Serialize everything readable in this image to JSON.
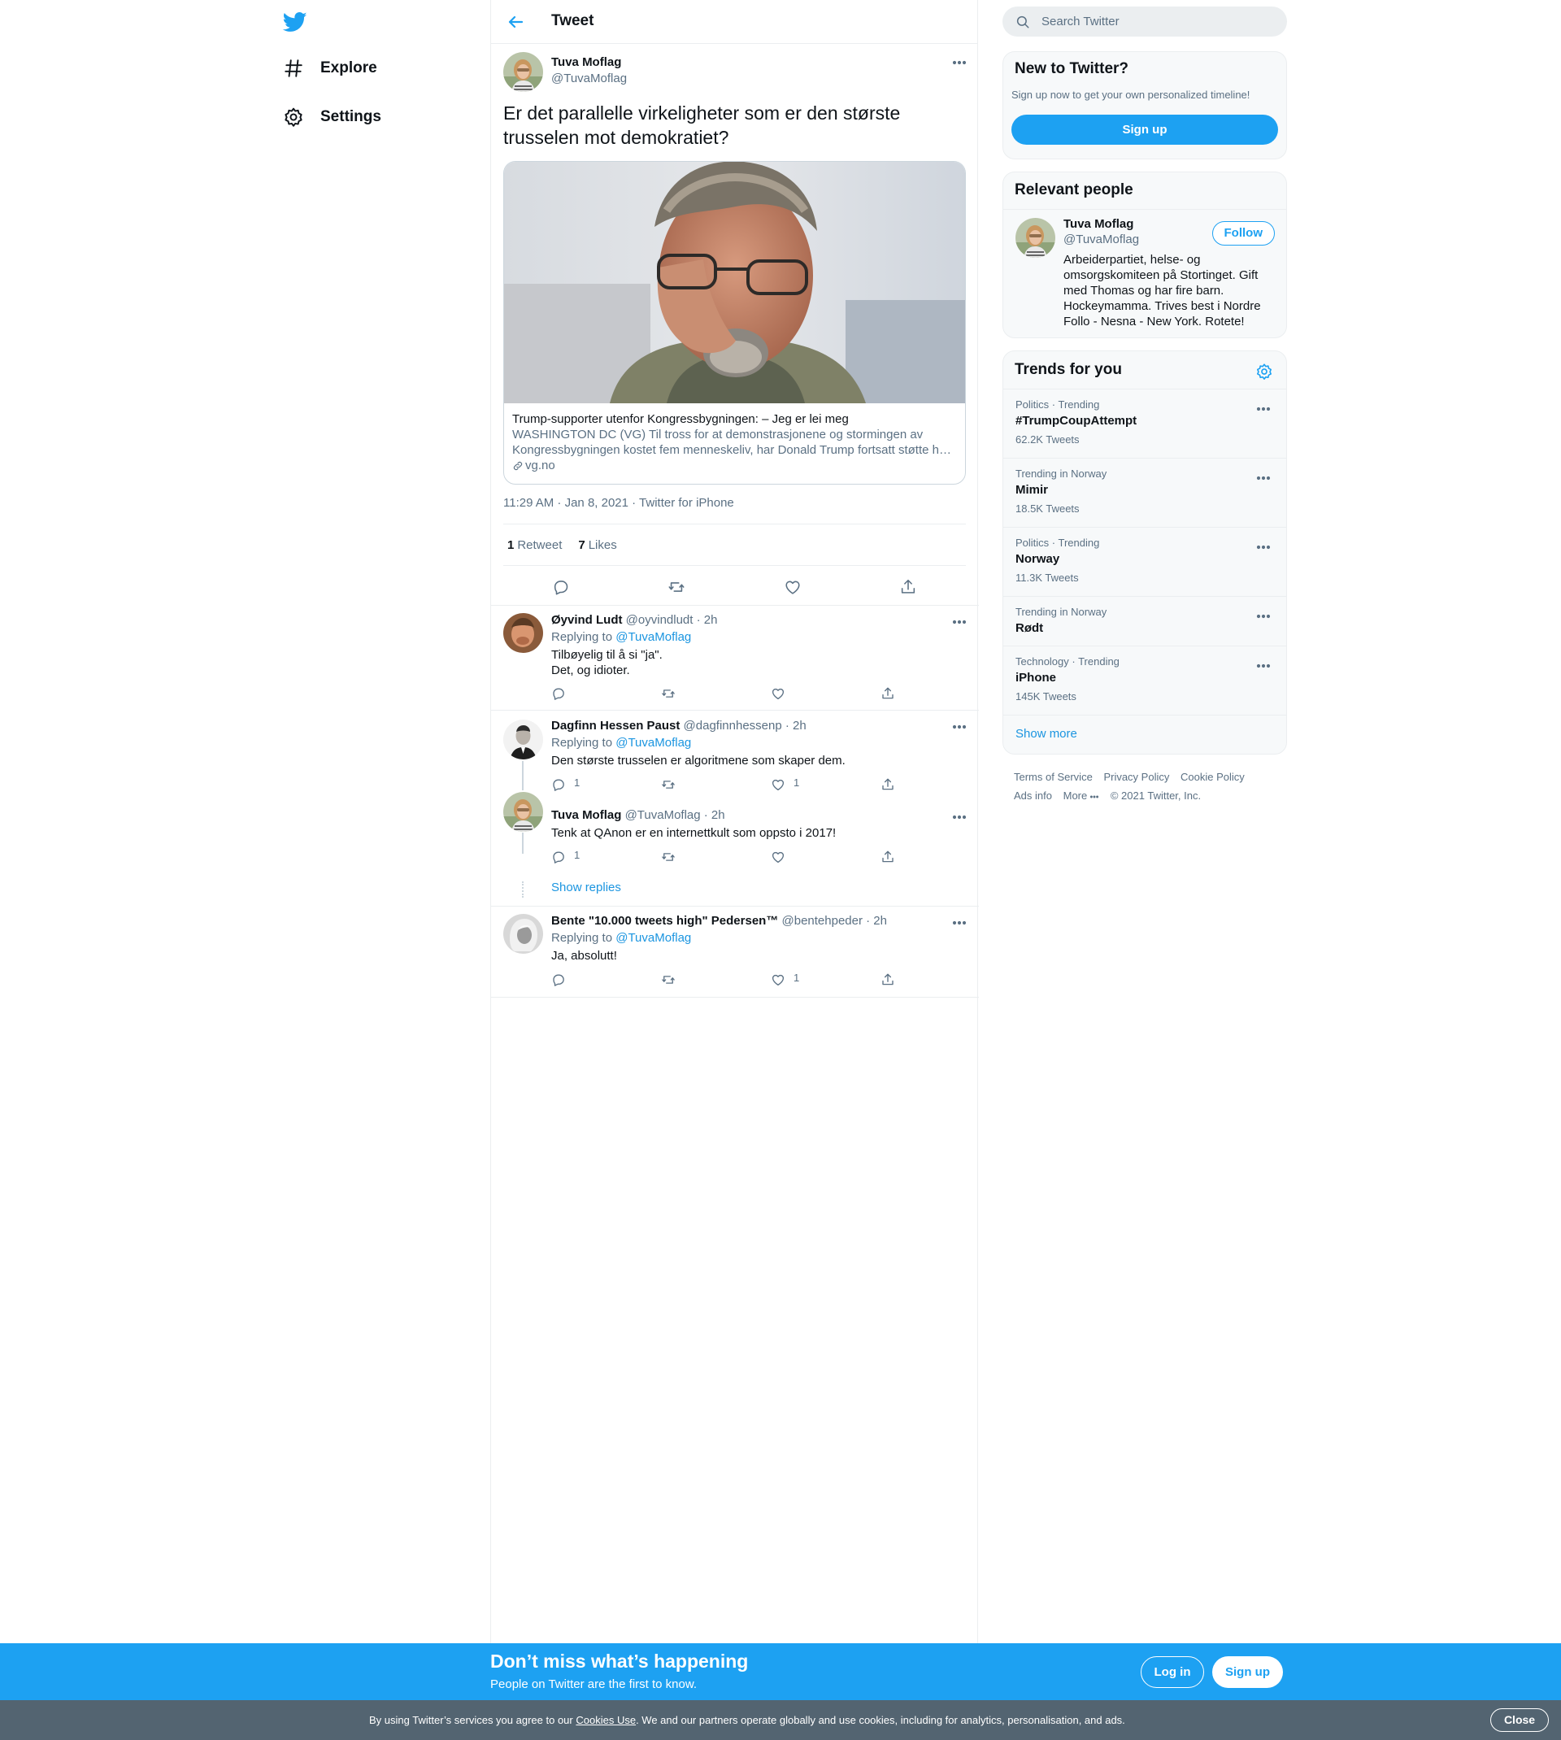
{
  "nav": {
    "explore_label": "Explore",
    "settings_label": "Settings"
  },
  "header": {
    "title": "Tweet"
  },
  "tweet": {
    "author_name": "Tuva Moflag",
    "author_handle": "@TuvaMoflag",
    "text": "Er det parallelle virkeligheter som er den største trusselen mot demokratiet?",
    "card": {
      "title": "Trump-supporter utenfor Kongressbygningen: – Jeg er lei meg",
      "desc_line1": "WASHINGTON DC (VG) Til tross for at demonstrasjonene og stormingen av",
      "desc_line2": "Kongressbygningen kostet fem menneskeliv, har Donald Trump fortsatt støtte h…",
      "domain": "vg.no"
    },
    "meta": "11:29 AM · Jan 8, 2021 · Twitter for iPhone",
    "retweets_count": "1",
    "retweets_label": "Retweet",
    "likes_count": "7",
    "likes_label": "Likes"
  },
  "replies": [
    {
      "name": "Øyvind Ludt",
      "handle": "@oyvindludt · 2h",
      "replying_prefix": "Replying to",
      "replying_to": "@TuvaMoflag",
      "text_line1": "Tilbøyelig til å si \"ja\".",
      "text_line2": "Det, og idioter.",
      "reply_count": "",
      "like_count": ""
    },
    {
      "name": "Dagfinn Hessen Paust",
      "handle": "@dagfinnhessenp · 2h",
      "replying_prefix": "Replying to",
      "replying_to": "@TuvaMoflag",
      "text_line1": "Den største trusselen er algoritmene som skaper dem.",
      "reply_count": "1",
      "like_count": "1"
    },
    {
      "name": "Tuva Moflag",
      "handle": "@TuvaMoflag · 2h",
      "text_line1": "Tenk at QAnon er en internettkult som oppsto i 2017!",
      "reply_count": "1",
      "like_count": ""
    },
    {
      "name": "Bente \"10.000 tweets high\" Pedersen™",
      "handle": "@bentehpeder · 2h",
      "replying_prefix": "Replying to",
      "replying_to": "@TuvaMoflag",
      "text_line1": "Ja, absolutt!",
      "reply_count": "",
      "like_count": "1"
    }
  ],
  "show_replies_label": "Show replies",
  "sidebar": {
    "search_placeholder": "Search Twitter",
    "new_to_twitter": {
      "title": "New to Twitter?",
      "subtitle": "Sign up now to get your own personalized timeline!",
      "signup_label": "Sign up"
    },
    "relevant_people": {
      "title": "Relevant people",
      "name": "Tuva Moflag",
      "handle": "@TuvaMoflag",
      "follow_label": "Follow",
      "bio_lines": [
        "Arbeiderpartiet, helse- og",
        "omsorgskomiteen på Stortinget. Gift",
        "med Thomas og har fire barn.",
        "Hockeymamma. Trives best i Nordre",
        "Follo - Nesna - New York. Rotete!"
      ]
    },
    "trends": {
      "title": "Trends for you",
      "items": [
        {
          "context": "Politics · Trending",
          "name": "#TrumpCoupAttempt",
          "count": "62.2K Tweets"
        },
        {
          "context": "Trending in Norway",
          "name": "Mimir",
          "count": "18.5K Tweets"
        },
        {
          "context": "Politics · Trending",
          "name": "Norway",
          "count": "11.3K Tweets"
        },
        {
          "context": "Trending in Norway",
          "name": "Rødt",
          "count": ""
        },
        {
          "context": "Technology · Trending",
          "name": "iPhone",
          "count": "145K Tweets"
        }
      ],
      "show_more_label": "Show more"
    },
    "footer": {
      "terms": "Terms of Service",
      "privacy": "Privacy Policy",
      "cookie": "Cookie Policy",
      "ads": "Ads info",
      "more": "More",
      "copyright": "© 2021 Twitter, Inc."
    }
  },
  "banner": {
    "title": "Don’t miss what’s happening",
    "subtitle": "People on Twitter are the first to know.",
    "login_label": "Log in",
    "signup_label": "Sign up"
  },
  "cookie_bar": {
    "text_before": "By using Twitter’s services you agree to our ",
    "link": "Cookies Use",
    "text_after": ". We and our partners operate globally and use cookies, including for analytics, personalisation, and ads.",
    "close_label": "Close"
  },
  "colors": {
    "accent": "#1da1f2",
    "link": "#1b95e0",
    "secondary_text": "#5b7083",
    "cookie_bar": "#536471"
  }
}
